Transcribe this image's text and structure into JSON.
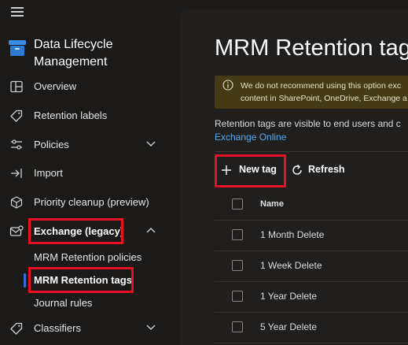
{
  "app": {
    "title_line1": "Data Lifecycle",
    "title_line2": "Management"
  },
  "sidebar": {
    "items": [
      {
        "label": "Overview",
        "icon": "layout-icon"
      },
      {
        "label": "Retention labels",
        "icon": "tag-icon"
      },
      {
        "label": "Policies",
        "icon": "sliders-icon"
      },
      {
        "label": "Import",
        "icon": "import-icon"
      },
      {
        "label": "Priority cleanup (preview)",
        "icon": "cube-icon"
      },
      {
        "label": "Exchange (legacy)",
        "icon": "mail-icon"
      },
      {
        "label": "Classifiers",
        "icon": "tag-icon"
      }
    ],
    "exchange_sub": [
      {
        "label": "MRM Retention policies"
      },
      {
        "label": "MRM Retention tags"
      },
      {
        "label": "Journal rules"
      }
    ]
  },
  "main": {
    "title": "MRM Retention tag",
    "warning_line1": "We do not recommend using this option exc",
    "warning_line2": "content in SharePoint, OneDrive, Exchange a",
    "description": "Retention tags are visible to end users and c",
    "link": "Exchange Online",
    "toolbar": {
      "new_tag": "New tag",
      "refresh": "Refresh"
    },
    "table": {
      "header": "Name",
      "rows": [
        "1 Month Delete",
        "1 Week Delete",
        "1 Year Delete",
        "5 Year Delete"
      ]
    }
  },
  "colors": {
    "background": "#1b1a19",
    "panel": "#201f1e",
    "accent": "#2f6fd6",
    "link": "#5aa9f0",
    "highlight": "#e81123",
    "warning_bg": "#453a14"
  }
}
